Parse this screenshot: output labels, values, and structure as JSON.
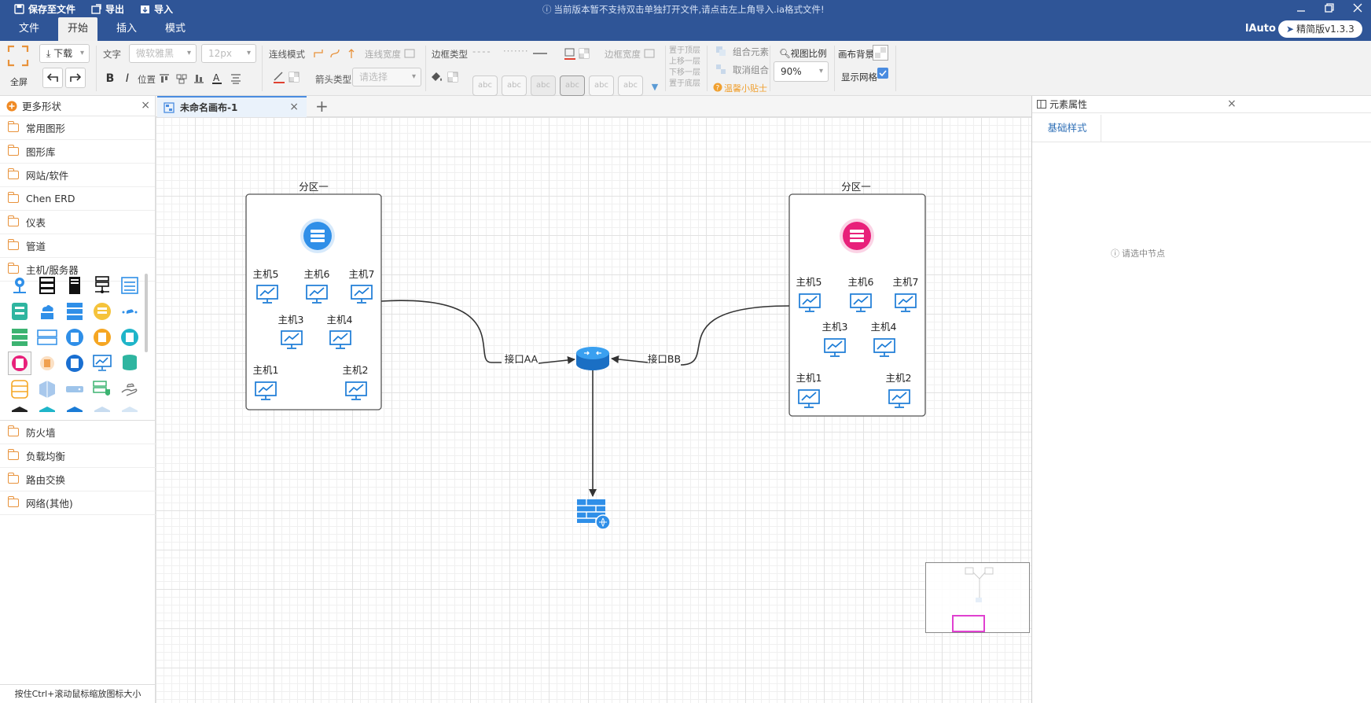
{
  "titlebar": {
    "save": "保存至文件",
    "export": "导出",
    "import": "导入",
    "notice": "当前版本暂不支持双击单独打开文件,请点击左上角导入.ia格式文件!"
  },
  "menubar": {
    "tabs": [
      "文件",
      "开始",
      "插入",
      "模式"
    ],
    "active_tab": "开始",
    "user": "lAuto",
    "version": "精简版v1.3.3"
  },
  "toolbar": {
    "fullscreen": "全屏",
    "download": "下载",
    "text_label": "文字",
    "font_family": "微软雅黑",
    "font_size": "12px",
    "position_label": "位置",
    "line_mode": "连线模式",
    "line_width": "连线宽度",
    "arrow_type": "箭头类型",
    "arrow_placeholder": "请选择",
    "border_type": "边框类型",
    "border_width": "边框宽度",
    "style_sample": "abc",
    "layer_ops": [
      "置于顶层",
      "上移一层",
      "下移一层",
      "置于底层"
    ],
    "group": "组合元素",
    "ungroup": "取消组合",
    "tips": "温馨小贴士",
    "zoom_label": "视图比例",
    "zoom_value": "90%",
    "canvas_bg": "画布背景",
    "show_grid": "显示网格",
    "show_grid_checked": true
  },
  "left_panel": {
    "header": "更多形状",
    "categories_top": [
      "常用图形",
      "图形库",
      "网站/软件",
      "Chen ERD",
      "仪表",
      "管道",
      "主机/服务器"
    ],
    "categories_bottom": [
      "防火墙",
      "负载均衡",
      "路由交换",
      "网络(其他)"
    ],
    "hint": "按住Ctrl+滚动鼠标缩放图标大小"
  },
  "canvas_tab": {
    "title": "未命名画布-1"
  },
  "diagram": {
    "zone_left": {
      "title": "分区一",
      "hosts": [
        "主机5",
        "主机6",
        "主机7",
        "主机3",
        "主机4",
        "主机1",
        "主机2"
      ],
      "server_color": "#2f8fe8"
    },
    "zone_right": {
      "title": "分区一",
      "hosts": [
        "主机5",
        "主机6",
        "主机7",
        "主机3",
        "主机4",
        "主机1",
        "主机2"
      ],
      "server_color": "#e8207a"
    },
    "link_left_label": "接口AA",
    "link_right_label": "接口BB",
    "router_color": "#2f8fe8",
    "firewall_color": "#2f8fe8",
    "monitor_color": "#1a7bd6"
  },
  "right_panel": {
    "header": "元素属性",
    "tab": "基础样式",
    "empty_text": "请选中节点"
  },
  "colors": {
    "header_bg": "#2f5597",
    "accent": "#4a8ce0",
    "folder": "#e8923b"
  }
}
